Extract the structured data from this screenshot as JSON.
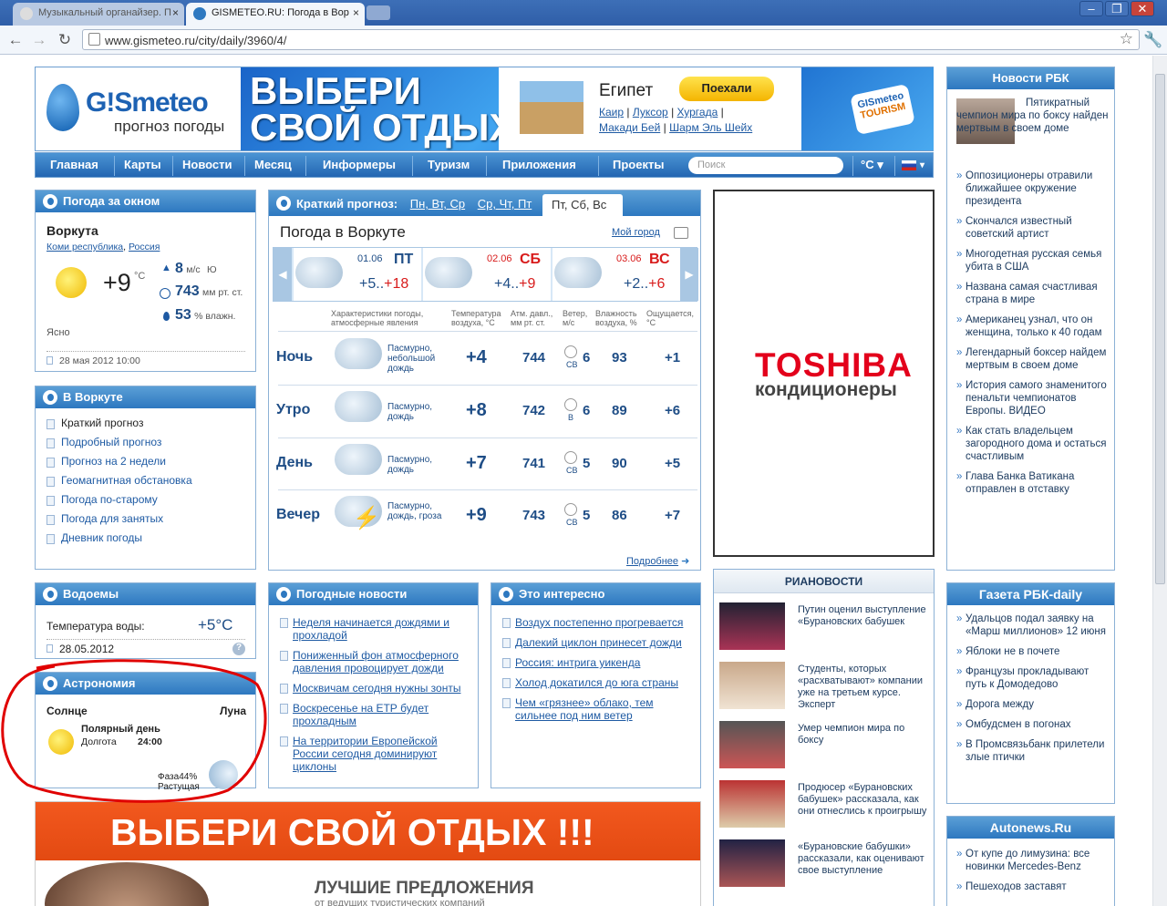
{
  "browser": {
    "tabs": [
      {
        "label": "Музыкальный органайзер. П"
      },
      {
        "label": "GISMETEO.RU: Погода в Вор"
      }
    ],
    "url": "www.gismeteo.ru/city/daily/3960/4/"
  },
  "header": {
    "logo_main": "G!Smeteo",
    "logo_sub": "прогноз погоды",
    "banner_line1": "ВЫБЕРИ",
    "banner_line2": "СВОЙ ОТДЫХ",
    "country": "Египет",
    "go_button": "Поехали",
    "cities_row1": [
      "Каир",
      "Луксор",
      "Хургада"
    ],
    "cities_row2": [
      "Макади Бей",
      "Шарм Эль Шейх"
    ],
    "badge1": "GISmeteo",
    "badge2": "TOURISM"
  },
  "menu": {
    "items": [
      "Главная",
      "Карты",
      "Новости",
      "Месяц",
      "Информеры",
      "Туризм",
      "Приложения",
      "Проекты"
    ],
    "search_placeholder": "Поиск",
    "units": "°C ▾"
  },
  "now": {
    "title": "Погода за окном",
    "city": "Воркута",
    "region": "Коми республика",
    "country": "Россия",
    "temp": "+9",
    "temp_unit": "°C",
    "wind": "8",
    "wind_unit": "м/с",
    "wind_dir": "Ю",
    "pressure": "743",
    "pressure_unit": "мм рт. ст.",
    "humidity": "53",
    "humidity_unit": "% влажн.",
    "condition": "Ясно",
    "date": "28 мая 2012 10:00"
  },
  "incity": {
    "title": "В Воркуте",
    "items": [
      "Краткий прогноз",
      "Подробный прогноз",
      "Прогноз на 2 недели",
      "Геомагнитная обстановка",
      "Погода по-старому",
      "Погода для занятых",
      "Дневник погоды"
    ]
  },
  "water": {
    "title": "Водоемы",
    "label": "Температура воды:",
    "value": "+5°C",
    "date": "28.05.2012"
  },
  "astro": {
    "title": "Астрономия",
    "sun": "Солнце",
    "moon": "Луна",
    "day_type": "Полярный день",
    "duration_label": "Долгота",
    "duration": "24:00",
    "phase_label": "Фаза",
    "phase_value": "44%",
    "phase_state": "Растущая"
  },
  "forecast": {
    "title": "Краткий прогноз:",
    "tab1": "Пн, Вт, Ср",
    "tab2": "Ср, Чт, Пт",
    "tab3": "Пт, Сб, Вс",
    "heading": "Погода в Воркуте",
    "my_city": "Мой город",
    "days": [
      {
        "date": "01.06",
        "dow": "ПТ",
        "range": "+5..",
        "max": "+18"
      },
      {
        "date": "02.06",
        "dow": "СБ",
        "range": "+4..",
        "max": "+9"
      },
      {
        "date": "03.06",
        "dow": "ВС",
        "range": "+2..",
        "max": "+6"
      }
    ],
    "cols": [
      "Характеристики погоды, атмосферные явления",
      "Температура воздуха, °С",
      "Атм. давл., мм рт. ст.",
      "Ветер, м/с",
      "Влажность воздуха, %",
      "Ощущается, °С"
    ],
    "rows": [
      {
        "period": "Ночь",
        "desc": "Пасмурно, небольшой дождь",
        "temp": "+4",
        "press": "744",
        "dir": "СВ",
        "wind": "6",
        "hum": "93",
        "feel": "+1"
      },
      {
        "period": "Утро",
        "desc": "Пасмурно, дождь",
        "temp": "+8",
        "press": "742",
        "dir": "В",
        "wind": "6",
        "hum": "89",
        "feel": "+6"
      },
      {
        "period": "День",
        "desc": "Пасмурно, дождь",
        "temp": "+7",
        "press": "741",
        "dir": "СВ",
        "wind": "5",
        "hum": "90",
        "feel": "+5"
      },
      {
        "period": "Вечер",
        "desc": "Пасмурно, дождь, гроза",
        "temp": "+9",
        "press": "743",
        "dir": "СВ",
        "wind": "5",
        "hum": "86",
        "feel": "+7"
      }
    ],
    "more": "Подробнее"
  },
  "ad": {
    "brand": "TOSHIBA",
    "sub": "кондиционеры"
  },
  "weather_news": {
    "title": "Погодные новости",
    "items": [
      "Неделя начинается дождями и прохладой",
      "Пониженный фон атмосферного давления провоцирует дожди",
      "Москвичам сегодня нужны зонты",
      "Воскресенье на ЕТР будет прохладным",
      "На территории Европейской России сегодня доминируют циклоны"
    ]
  },
  "interesting": {
    "title": "Это интересно",
    "items": [
      "Воздух постепенно прогревается",
      "Далекий циклон принесет дожди",
      "Россия: интрига уикенда",
      "Холод докатился до юга страны",
      "Чем «грязнее» облако, тем сильнее под ним ветер"
    ]
  },
  "rbk": {
    "title": "Новости РБК",
    "lead": "Пятикратный чемпион мира по боксу найден мертвым в своем доме",
    "items": [
      "Оппозиционеры отравили ближайшее окружение президента",
      "Скончался известный советский артист",
      "Многодетная русская семья убита в США",
      "Названа самая счастливая страна в мире",
      "Американец узнал, что он женщина, только к 40 годам",
      "Легендарный боксер найдем мертвым в своем доме",
      "История самого знаменитого пенальти чемпионатов Европы. ВИДЕО",
      "Как стать владельцем загородного дома и остаться счастливым",
      "Глава Банка Ватикана отправлен в отставку"
    ]
  },
  "ria": {
    "title": "РИАНОВОСТИ",
    "items": [
      "Путин оценил выступление «Бурановских бабушек",
      "Студенты, которых «расхватывают» компании уже на третьем курсе. Эксперт",
      "Умер чемпион мира по боксу",
      "Продюсер «Бурановских бабушек» рассказала, как они отнеслись к проигрышу",
      "«Бурановские бабушки» рассказали, как оценивают свое выступление"
    ]
  },
  "rbk_daily": {
    "title": "Газета РБК-daily",
    "items": [
      "Удальцов подал заявку на «Марш миллионов» 12 июня",
      "Яблоки не в почете",
      "Французы прокладывают путь к Домодедово",
      "Дорога между",
      "Омбудсмен в погонах",
      "В Промсвязьбанк прилетели злые птички"
    ]
  },
  "autonews": {
    "title": "Autonews.Ru",
    "items": [
      "От купе до лимузина: все новинки Mercedes-Benz",
      "Пешеходов заставят"
    ]
  },
  "bottom_banner": {
    "title": "ВЫБЕРИ СВОЙ ОТДЫХ !!!",
    "sub": "ЛУЧШИЕ ПРЕДЛОЖЕНИЯ",
    "sub2": "от ведущих туристических компаний"
  },
  "colors": {
    "accent": "#2d78c0",
    "red": "#d81b1b",
    "annotation": "#e00000"
  }
}
